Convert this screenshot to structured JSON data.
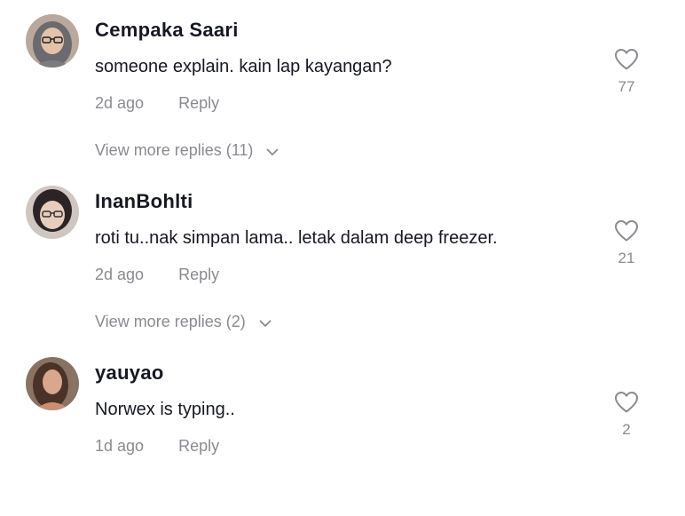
{
  "colors": {
    "primary_text": "#161823",
    "secondary_text": "#8a8b91",
    "icon_stroke": "#8a8b91",
    "background": "#ffffff"
  },
  "comments": [
    {
      "avatar_icon": "avatar-photo",
      "username": "Cempaka Saari",
      "text": "someone explain. kain lap kayangan?",
      "time": "2d ago",
      "reply_label": "Reply",
      "likes": "77",
      "view_more": "View more replies (11)"
    },
    {
      "avatar_icon": "avatar-photo",
      "username": "InanBohlti",
      "text": "roti tu..nak simpan lama.. letak dalam deep freezer.",
      "time": "2d ago",
      "reply_label": "Reply",
      "likes": "21",
      "view_more": "View more replies (2)"
    },
    {
      "avatar_icon": "avatar-photo",
      "username": "yauyao",
      "text": "Norwex is typing..",
      "time": "1d ago",
      "reply_label": "Reply",
      "likes": "2",
      "view_more": ""
    }
  ]
}
